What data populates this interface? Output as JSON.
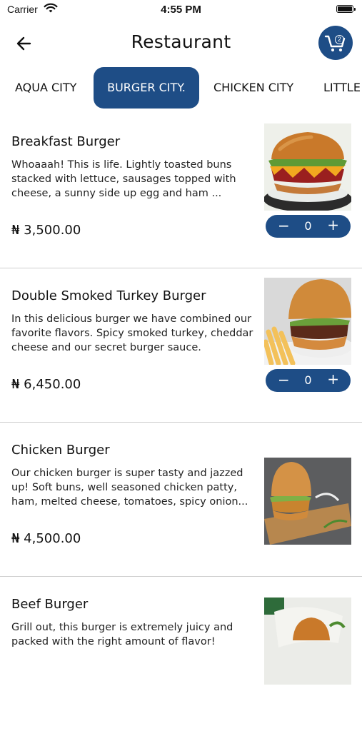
{
  "status_bar": {
    "carrier": "Carrier",
    "time": "4:55 PM"
  },
  "header": {
    "title": "Restaurant",
    "cart_count": "2"
  },
  "tabs": [
    {
      "label": "AQUA CITY"
    },
    {
      "label": "BURGER CITY.",
      "active": true
    },
    {
      "label": "CHICKEN CITY"
    },
    {
      "label": "LITTLE C"
    }
  ],
  "colors": {
    "accent": "#1e4d86",
    "divider": "#cfcfcf"
  },
  "icons": [
    "back-arrow-icon",
    "cart-icon",
    "wifi-icon",
    "battery-icon"
  ],
  "items": [
    {
      "name": "Breakfast Burger",
      "description": "Whoaaah! This is life. Lightly toasted buns stacked with lettuce,  sausages topped with cheese, a sunny side up egg and ham ...",
      "price": "₦ 3,500.00",
      "quantity": "0",
      "minus": "−",
      "plus": "+"
    },
    {
      "name": "Double Smoked Turkey Burger",
      "description": "In this delicious burger we have combined our favorite flavors. Spicy smoked turkey, cheddar cheese and our secret burger sauce.",
      "price": "₦ 6,450.00",
      "quantity": "0",
      "minus": "−",
      "plus": "+"
    },
    {
      "name": "Chicken Burger",
      "description": "Our chicken burger is super tasty and jazzed up! Soft buns, well seasoned chicken patty, ham, melted cheese, tomatoes, spicy onion...",
      "price": "₦ 4,500.00"
    },
    {
      "name": "Beef Burger",
      "description": "Grill out, this burger is extremely juicy and packed with the right amount of flavor!"
    }
  ]
}
